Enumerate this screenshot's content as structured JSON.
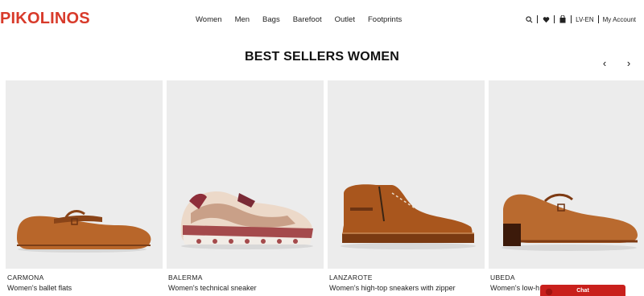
{
  "brand": {
    "logo": "PIKOLINOS",
    "color": "#d83a2a"
  },
  "nav": {
    "items": [
      {
        "label": "Women"
      },
      {
        "label": "Men"
      },
      {
        "label": "Bags"
      },
      {
        "label": "Barefoot"
      },
      {
        "label": "Outlet"
      },
      {
        "label": "Footprints"
      }
    ]
  },
  "utils": {
    "search_icon": "search-icon",
    "wishlist_icon": "heart-icon",
    "bag_icon": "bag-icon",
    "locale": "LV-EN",
    "account": "My Account"
  },
  "section": {
    "title": "BEST SELLERS WOMEN",
    "prev": "‹",
    "next": "›"
  },
  "products": [
    {
      "name": "CARMONA",
      "desc": "Women's ballet flats",
      "color": "#b8662a"
    },
    {
      "name": "BALERMA",
      "desc": "Women's technical sneaker",
      "color": "#e8d4c3"
    },
    {
      "name": "LANZAROTE",
      "desc": "Women's high-top sneakers with zipper",
      "color": "#a9561d"
    },
    {
      "name": "UBEDA",
      "desc": "Women's low-h",
      "color": "#b96a2f"
    }
  ],
  "chat": {
    "label": "Chat",
    "color": "#c9201c"
  }
}
